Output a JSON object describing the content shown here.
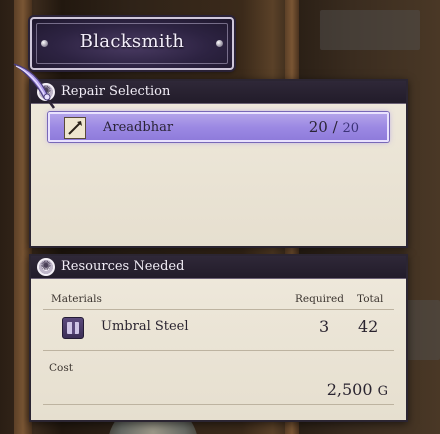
{
  "title": "Blacksmith",
  "repair": {
    "header": "Repair Selection",
    "item_name": "Areadbhar",
    "uses_current": "20",
    "uses_sep": " / ",
    "uses_max": "20"
  },
  "resources": {
    "header": "Resources Needed",
    "col_materials": "Materials",
    "col_required": "Required",
    "col_total": "Total",
    "material_name": "Umbral Steel",
    "material_required": "3",
    "material_total": "42",
    "cost_label": "Cost",
    "cost_value": "2,500",
    "cost_unit": "G"
  },
  "icons": [
    "gear-icon",
    "quill-cursor-icon",
    "lance-icon",
    "umbral-steel-icon"
  ],
  "colors": {
    "highlight": "#9c89e3",
    "panel": "#e6dfcf",
    "header": "#221c2a",
    "title_plate": "#2d2342"
  }
}
